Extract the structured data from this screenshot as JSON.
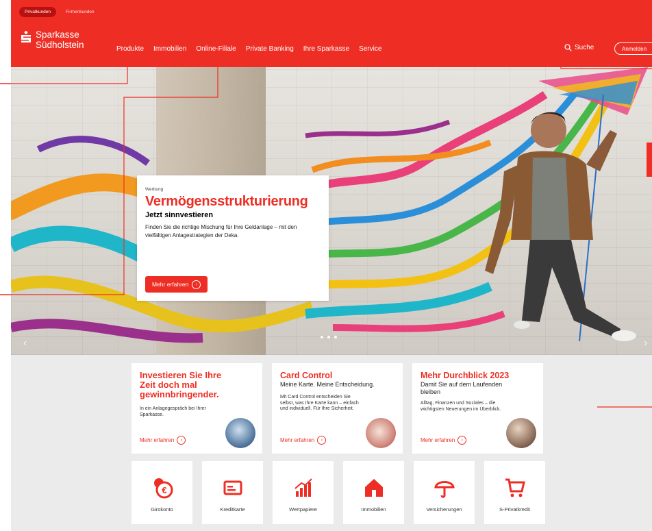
{
  "header": {
    "segments": [
      "Privatkunden",
      "Firmenkunden"
    ],
    "brand_line1": "Sparkasse",
    "brand_line2": "Südholstein",
    "nav": [
      "Produkte",
      "Immobilien",
      "Online-Filiale",
      "Private Banking",
      "Ihre Sparkasse",
      "Service"
    ],
    "search_label": "Suche",
    "login_label": "Anmelden"
  },
  "hero": {
    "ad_label": "Werbung",
    "headline": "Vermögensstrukturierung",
    "subheadline": "Jetzt sinnvestieren",
    "text": "Finden Sie die richtige Mischung für Ihre Geldanlage – mit den vielfältigen Anlagestrategien der Deka.",
    "button_label": "Mehr erfahren",
    "slide_count": 3,
    "active_slide": 1
  },
  "teasers": [
    {
      "headline": "Investieren Sie Ihre Zeit doch mal gewinnbringender.",
      "subline": "",
      "body": "In ein Anlagegespräch bei Ihrer Sparkasse.",
      "link": "Mehr erfahren"
    },
    {
      "headline": "Card Control",
      "subline": "Meine Karte. Meine Entscheidung.",
      "body": "Mit Card Control entscheiden Sie selbst, was Ihre Karte kann – einfach und individuell. Für Ihre Sicherheit.",
      "link": "Mehr erfahren"
    },
    {
      "headline": "Mehr Durchblick 2023",
      "subline": "Damit Sie auf dem Laufenden bleiben",
      "body": "Alltag, Finanzen und Soziales – die wichtigsten Neuerungen im Überblick.",
      "link": "Mehr erfahren"
    }
  ],
  "categories": [
    {
      "label": "Girokonto",
      "icon": "euro-coins-icon"
    },
    {
      "label": "Kreditkarte",
      "icon": "credit-card-icon"
    },
    {
      "label": "Wertpapiere",
      "icon": "bar-chart-icon"
    },
    {
      "label": "Immobilien",
      "icon": "house-icon"
    },
    {
      "label": "Versicherungen",
      "icon": "umbrella-icon"
    },
    {
      "label": "S-Privatkredit",
      "icon": "shopping-cart-icon"
    }
  ],
  "colors": {
    "brand_red": "#ee2e24",
    "dark_red": "#b9110f",
    "page_bg": "#ebebeb"
  }
}
